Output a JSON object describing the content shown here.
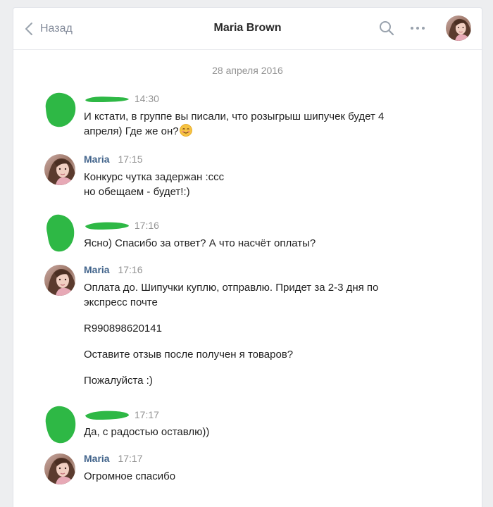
{
  "header": {
    "back_label": "Назад",
    "title": "Maria Brown"
  },
  "date_separator": "28 апреля 2016",
  "colors": {
    "link": "#42648b",
    "muted": "#939393",
    "redaction": "#2eb845",
    "text": "#1f1f1f"
  },
  "messages": [
    {
      "author": "",
      "author_redacted": true,
      "time": "14:30",
      "lines": [
        "И кстати, в группе вы писали, что розыгрыш шипучек будет 4",
        "апреля) Где же он?"
      ],
      "emoji": "smiling-face-emoji"
    },
    {
      "author": "Maria",
      "author_redacted": false,
      "time": "17:15",
      "lines": [
        "Конкурс чутка задержан :ссс",
        "но обещаем - будет!:)"
      ]
    },
    {
      "author": "",
      "author_redacted": true,
      "time": "17:16",
      "lines": [
        "Ясно) Спасибо за ответ? А что насчёт оплаты?"
      ]
    },
    {
      "author": "Maria",
      "author_redacted": false,
      "time": "17:16",
      "paragraphs": [
        [
          "Оплата до. Шипучки куплю, отправлю. Придет за 2-3 дня по",
          "экспресс почте"
        ],
        [
          "R990898620141"
        ],
        [
          "Оставите отзыв после получен я товаров?"
        ],
        [
          "Пожалуйста :)"
        ]
      ]
    },
    {
      "author": "",
      "author_redacted": true,
      "time": "17:17",
      "lines": [
        "Да, с радостью оставлю))"
      ]
    },
    {
      "author": "Maria",
      "author_redacted": false,
      "time": "17:17",
      "lines": [
        "Огромное спасибо"
      ]
    }
  ]
}
